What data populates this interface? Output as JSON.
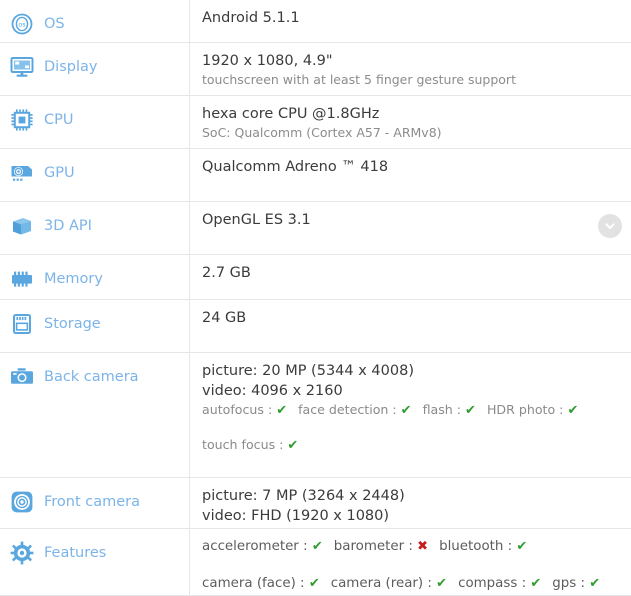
{
  "rows": [
    {
      "id": "os",
      "icon": "os-icon",
      "label": "OS",
      "main": "Android 5.1.1",
      "sub": ""
    },
    {
      "id": "display",
      "icon": "display-icon",
      "label": "Display",
      "main": "1920 x 1080, 4.9\"",
      "sub": "touchscreen with at least 5 finger gesture support"
    },
    {
      "id": "cpu",
      "icon": "cpu-icon",
      "label": "CPU",
      "main": "hexa core CPU @1.8GHz",
      "sub": "SoC: Qualcomm (Cortex A57 - ARMv8)"
    },
    {
      "id": "gpu",
      "icon": "gpu-icon",
      "label": "GPU",
      "main": "Qualcomm Adreno ™ 418",
      "sub": ""
    },
    {
      "id": "3d-api",
      "icon": "cube-icon",
      "label": "3D API",
      "main": "OpenGL ES 3.1",
      "sub": "",
      "expand_icon": "chevron-down-icon"
    },
    {
      "id": "memory",
      "icon": "memory-icon",
      "label": "Memory",
      "main": "2.7 GB",
      "sub": ""
    },
    {
      "id": "storage",
      "icon": "storage-icon",
      "label": "Storage",
      "main": "24 GB",
      "sub": ""
    },
    {
      "id": "back-camera",
      "icon": "camera-icon",
      "label": "Back camera",
      "main": "picture: 20 MP (5344 x 4008)",
      "main2": "video: 4096 x 2160",
      "features_line1": [
        {
          "name": "autofocus",
          "value": "yes"
        },
        {
          "name": "face detection",
          "value": "yes"
        },
        {
          "name": "flash",
          "value": "yes"
        },
        {
          "name": "HDR photo",
          "value": "yes"
        }
      ],
      "features_line2": [
        {
          "name": "touch focus",
          "value": "yes"
        }
      ]
    },
    {
      "id": "front-camera",
      "icon": "front-camera-icon",
      "label": "Front camera",
      "main": "picture: 7 MP (3264 x 2448)",
      "main2": "video: FHD (1920 x 1080)"
    },
    {
      "id": "features",
      "icon": "gear-icon",
      "label": "Features",
      "features_line1": [
        {
          "name": "accelerometer",
          "value": "yes"
        },
        {
          "name": "barometer",
          "value": "no"
        },
        {
          "name": "bluetooth",
          "value": "yes"
        }
      ],
      "features_line2": [
        {
          "name": "camera (face)",
          "value": "yes"
        },
        {
          "name": "camera (rear)",
          "value": "yes"
        },
        {
          "name": "compass",
          "value": "yes"
        },
        {
          "name": "gps",
          "value": "yes"
        }
      ]
    }
  ],
  "glyphs": {
    "tick": "✔",
    "cross": "✖",
    "separator": ":"
  },
  "colors": {
    "label_blue": "#7cb4e8",
    "icon_blue": "#5aa7e0",
    "value_dark": "#3b3b3b",
    "value_muted": "#8c8c8c",
    "tick_green": "#2e9c2e",
    "cross_red": "#c81c1c",
    "row_border": "#e4e6e8",
    "chevron_bg": "#e2e2e2"
  }
}
